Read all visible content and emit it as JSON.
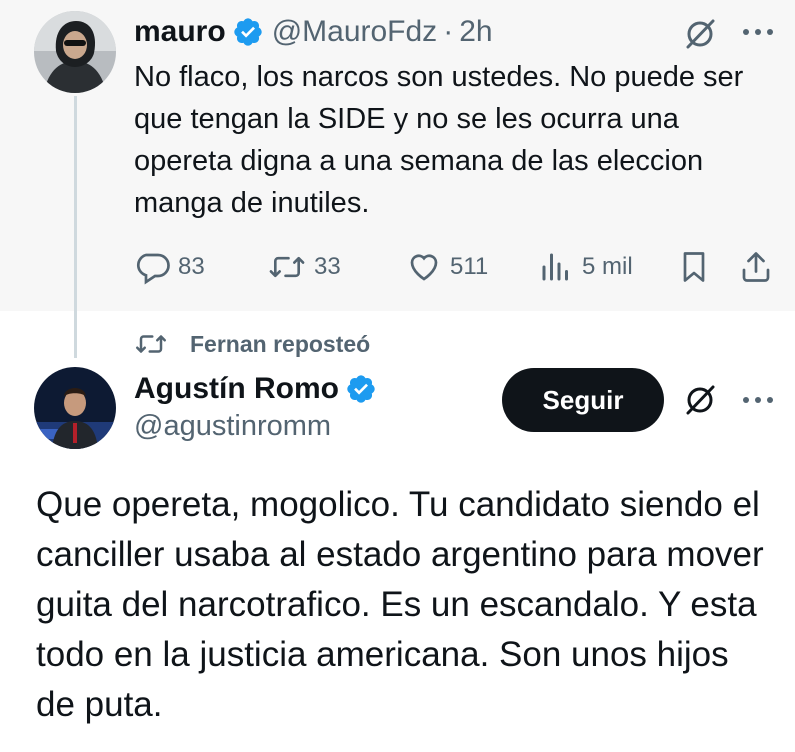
{
  "parent_tweet": {
    "author_name": "mauro",
    "author_handle": "@MauroFdz",
    "separator": "·",
    "time": "2h",
    "text": "No flaco, los narcos son ustedes. No puede ser que tengan la SIDE y no se les ocurra una opereta digna a una semana de las eleccion manga de inutiles.",
    "actions": {
      "replies": "83",
      "reposts": "33",
      "likes": "511",
      "views": "5 mil"
    }
  },
  "repost_context": {
    "label": "Fernan reposteó"
  },
  "main_tweet": {
    "author_name": "Agustín Romo",
    "author_handle": "@agustinromm",
    "follow_label": "Seguir",
    "text": "Que opereta, mogolico. Tu candidato siendo el canciller usaba al estado argentino para mover guita del narcotrafico. Es un escandalo. Y esta todo en la justicia americana. Son unos hijos de puta."
  },
  "colors": {
    "verified_badge": "#1d9bf0",
    "follow_button": "#0f1419",
    "muted_text": "#536471",
    "parent_background": "#f7f7f7"
  },
  "icons": [
    "verified-badge-icon",
    "grok-icon",
    "more-icon",
    "reply-icon",
    "repost-icon",
    "like-icon",
    "views-icon",
    "bookmark-icon",
    "share-icon"
  ]
}
